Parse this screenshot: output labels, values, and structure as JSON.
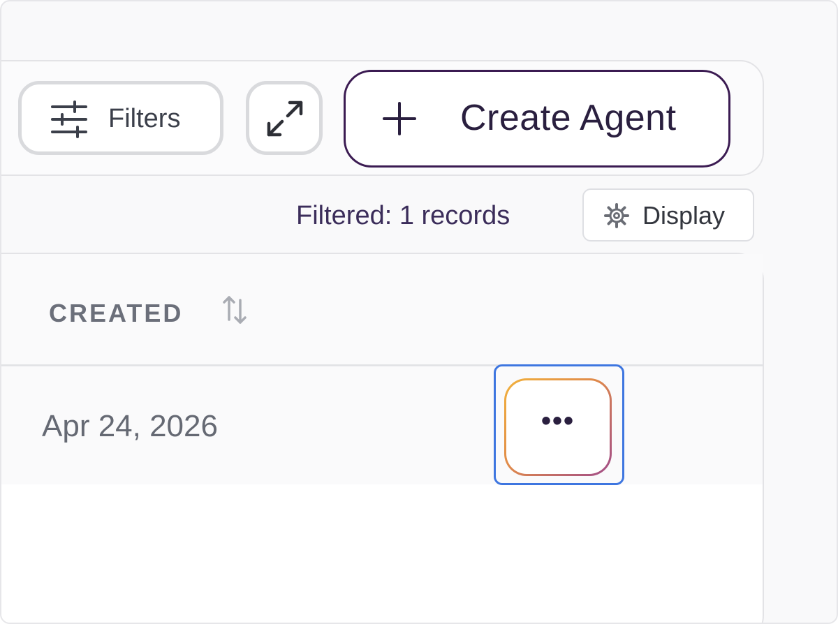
{
  "toolbar": {
    "filters_label": "Filters",
    "filters_icon": "sliders-icon",
    "expand_icon": "expand-icon",
    "create_label": "Create Agent",
    "create_icon": "plus-icon"
  },
  "status": {
    "filtered_text": "Filtered: 1 records",
    "display_label": "Display",
    "display_icon": "gear-icon"
  },
  "table": {
    "columns": [
      {
        "label": "CREATED",
        "sort_icon": "sort-arrows-icon"
      }
    ],
    "rows": [
      {
        "created": "Apr 24, 2026",
        "actions_label": "•••",
        "actions_icon": "more-icon"
      }
    ]
  },
  "colors": {
    "accent": "#3b1b52",
    "focus": "#3e76e0"
  }
}
